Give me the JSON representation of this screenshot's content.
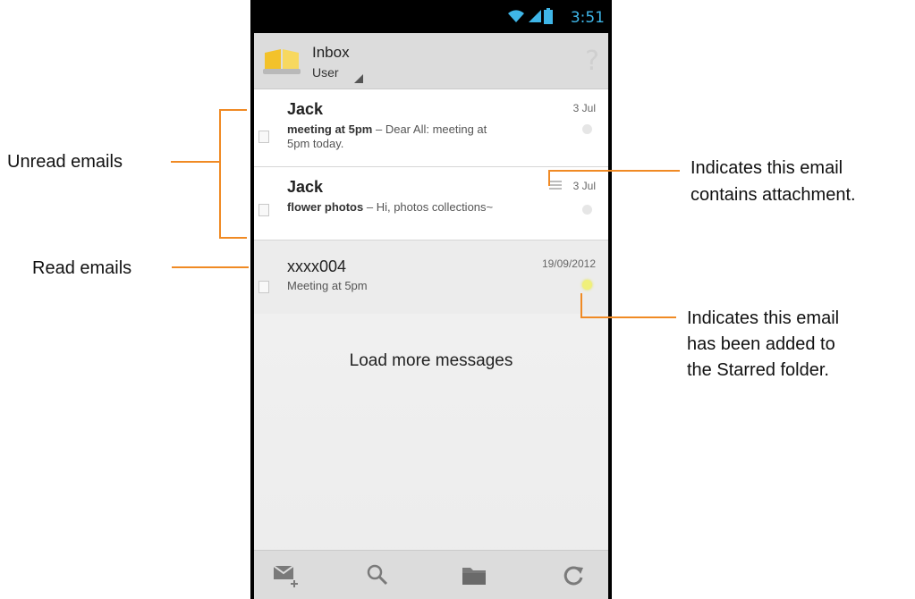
{
  "status_bar": {
    "time": "3:51"
  },
  "header": {
    "title": "Inbox",
    "account": "User"
  },
  "emails": [
    {
      "sender": "Jack",
      "date": "3 Jul",
      "subject": "meeting at 5pm",
      "separator": " – ",
      "preview_line1": "Dear All: meeting at",
      "preview_line2": "5pm today.",
      "state": "unread"
    },
    {
      "sender": "Jack",
      "date": "3 Jul",
      "subject": "flower photos",
      "separator": " – ",
      "preview_line1": "Hi, photos collections~",
      "state": "unread",
      "has_attachment": true
    },
    {
      "sender": "xxxx004",
      "date": "19/09/2012",
      "preview_line1": "Meeting at 5pm",
      "state": "read",
      "starred": true
    }
  ],
  "load_more_label": "Load more messages",
  "bottom_bar": [
    "compose-icon",
    "search-icon",
    "folder-icon",
    "refresh-icon"
  ],
  "annotations": {
    "unread": "Unread emails",
    "read": "Read emails",
    "attachment_line1": "Indicates this email",
    "attachment_line2": "contains attachment.",
    "starred_line1": "Indicates this email",
    "starred_line2": "has been added to",
    "starred_line3": "the Starred folder."
  },
  "colors": {
    "annotation_line": "#f08a24",
    "status_accent": "#3fb6e8",
    "star": "#f0f07a"
  }
}
